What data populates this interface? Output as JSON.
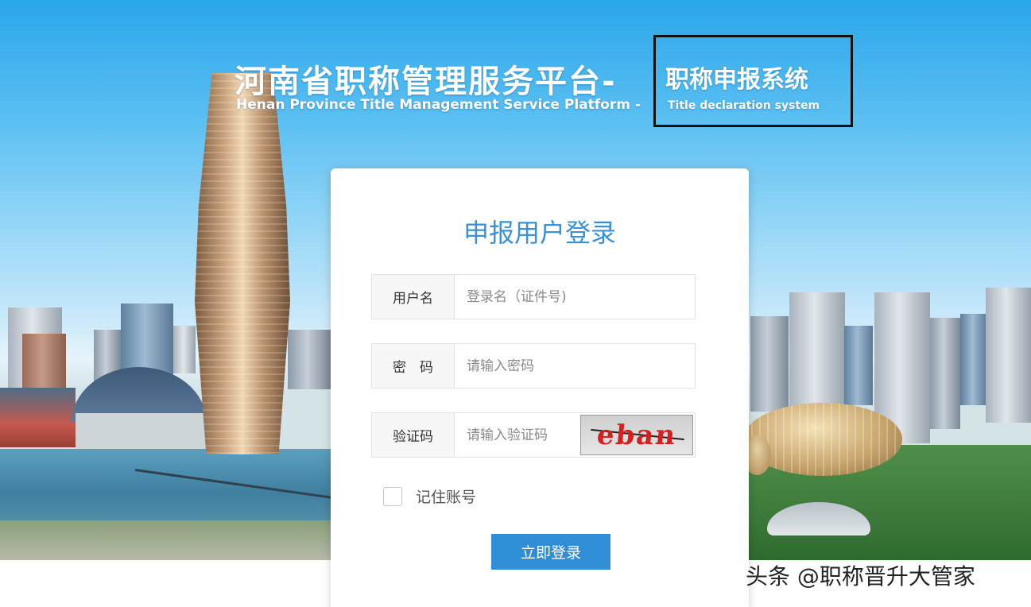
{
  "header": {
    "title_cn": "河南省职称管理服务平台-",
    "title_en": "Henan Province Title Management Service Platform -",
    "subtitle_cn": "职称申报系统",
    "subtitle_en": "Title declaration system"
  },
  "login": {
    "title": "申报用户登录",
    "username_label": "用户名",
    "username_placeholder": "登录名（证件号)",
    "password_label": "密　码",
    "password_placeholder": "请输入密码",
    "captcha_label": "验证码",
    "captcha_placeholder": "请输入验证码",
    "captcha_text": "eban",
    "remember_label": "记住账号",
    "submit_label": "立即登录"
  },
  "watermark": "头条 @职称晋升大管家",
  "colors": {
    "accent": "#3a91d3",
    "button": "#2f8ed6",
    "captcha_text": "#d62020"
  }
}
